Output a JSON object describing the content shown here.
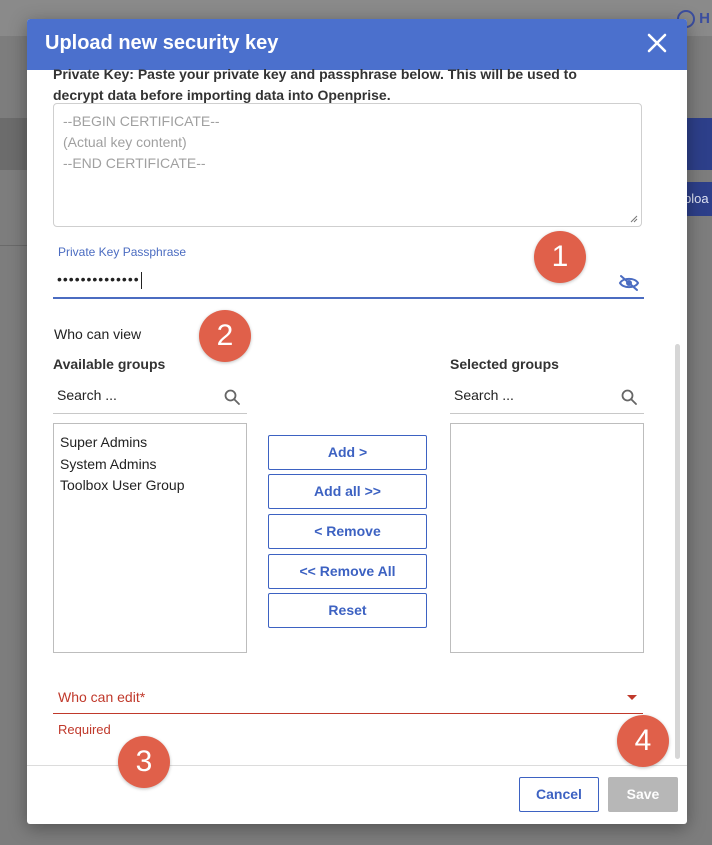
{
  "background": {
    "help_label": "H",
    "upload_fragment": "ploa"
  },
  "modal": {
    "title": "Upload new security key",
    "intro": "Private Key: Paste your private key and passphrase below. This will be used to decrypt data before importing data into Openprise.",
    "key_lines": [
      "--BEGIN CERTIFICATE--",
      "(Actual key content)",
      "--END CERTIFICATE--"
    ],
    "passphrase_label": "Private Key Passphrase",
    "passphrase_value": "••••••••••••••",
    "who_can_view": "Who can view",
    "available": {
      "title": "Available groups",
      "search_placeholder": "Search ...",
      "items": [
        "Super Admins",
        "System Admins",
        "Toolbox User Group"
      ]
    },
    "selected": {
      "title": "Selected groups",
      "search_placeholder": "Search ..."
    },
    "transfer_buttons": {
      "add": "Add >",
      "add_all": "Add all >>",
      "remove": "< Remove",
      "remove_all": "<< Remove All",
      "reset": "Reset"
    },
    "who_can_edit": "Who can edit*",
    "required_msg": "Required",
    "cancel": "Cancel",
    "save": "Save"
  },
  "callouts": [
    "1",
    "2",
    "3",
    "4"
  ],
  "colors": {
    "header": "#4b70cd",
    "accent": "#3d62c2",
    "error": "#c0392b",
    "callout": "#e0604a",
    "disabled": "#b7b7b7"
  },
  "icons": [
    "close-icon",
    "eye-slash-icon",
    "search-icon",
    "chevron-down-icon",
    "help-icon"
  ]
}
